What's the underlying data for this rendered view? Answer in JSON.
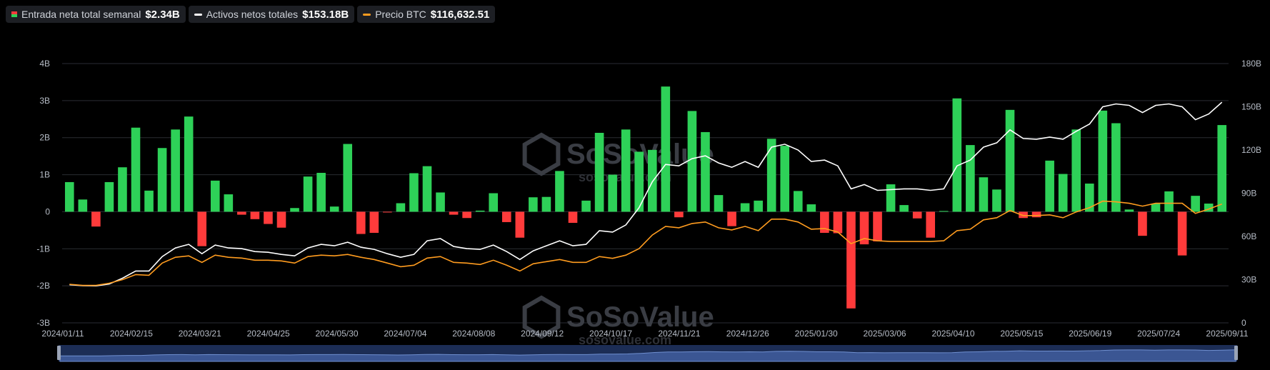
{
  "legend": {
    "inflow_label": "Entrada neta total semanal",
    "inflow_value": "$2.34B",
    "assets_label": "Activos netos totales",
    "assets_value": "$153.18B",
    "price_label": "Precio BTC",
    "price_value": "$116,632.51"
  },
  "watermark": {
    "text": "SoSoValue",
    "subtext": "sosovalue.com"
  },
  "colors": {
    "positive": "#2ed158",
    "negative": "#ff3b3b",
    "assets_line": "#ffffff",
    "price_line": "#ff9c1f"
  },
  "chart_data": {
    "type": "bar",
    "x_ticks": [
      "2024/01/11",
      "2024/02/15",
      "2024/03/21",
      "2024/04/25",
      "2024/05/30",
      "2024/07/04",
      "2024/08/08",
      "2024/09/12",
      "2024/10/17",
      "2024/11/21",
      "2024/12/26",
      "2025/01/30",
      "2025/03/06",
      "2025/04/10",
      "2025/05/15",
      "2025/06/19",
      "2025/07/24",
      "2025/09/11"
    ],
    "y_left": {
      "ticks": [
        "4B",
        "3B",
        "2B",
        "1B",
        "0",
        "-1B",
        "-2B",
        "-3B"
      ],
      "range": [
        -3,
        4
      ],
      "unit": "B"
    },
    "y_right": {
      "ticks": [
        "180B",
        "150B",
        "120B",
        "90B",
        "60B",
        "30B",
        "0"
      ],
      "range": [
        0,
        180
      ],
      "unit": "B"
    },
    "grid": true,
    "legend_position": "top-left",
    "series": [
      {
        "name": "Entrada neta total semanal",
        "type": "bar",
        "axis": "left",
        "values": [
          0.8,
          0.33,
          -0.4,
          0.8,
          1.2,
          2.27,
          0.57,
          1.72,
          2.22,
          2.57,
          -0.93,
          0.84,
          0.47,
          -0.08,
          -0.2,
          -0.33,
          -0.43,
          0.1,
          0.95,
          1.05,
          0.14,
          1.83,
          -0.6,
          -0.57,
          -0.02,
          0.23,
          1.04,
          1.23,
          0.52,
          -0.08,
          -0.17,
          0.03,
          0.5,
          -0.28,
          -0.7,
          0.39,
          0.4,
          1.1,
          -0.3,
          0.3,
          2.13,
          1.0,
          2.22,
          1.62,
          1.67,
          3.38,
          -0.15,
          2.72,
          2.15,
          0.45,
          -0.39,
          0.23,
          0.3,
          1.97,
          1.78,
          0.56,
          0.2,
          -0.57,
          -0.58,
          -2.61,
          -0.88,
          -0.8,
          0.74,
          0.18,
          -0.18,
          -0.7,
          0.02,
          3.06,
          1.8,
          0.93,
          0.6,
          2.75,
          -0.17,
          -0.15,
          1.38,
          1.02,
          2.22,
          0.76,
          2.73,
          2.39,
          0.06,
          -0.65,
          0.22,
          0.55,
          -1.18,
          0.43,
          0.22,
          2.34
        ]
      },
      {
        "name": "Activos netos totales",
        "type": "line",
        "axis": "right",
        "values": [
          26.5,
          25.8,
          25.7,
          27,
          31,
          36,
          36,
          46,
          52,
          54.5,
          48,
          54,
          52,
          51.5,
          49.5,
          49,
          47.5,
          46.5,
          52,
          54.5,
          53.5,
          56,
          52.5,
          51,
          48,
          45.5,
          47.5,
          57,
          58.5,
          53,
          51.5,
          51,
          54,
          49.5,
          44,
          50,
          53.5,
          57,
          53.5,
          54.5,
          64,
          63,
          68,
          80,
          98,
          110,
          109,
          114,
          116,
          111,
          108,
          112,
          108,
          122,
          124,
          120,
          112,
          113,
          109,
          93,
          96,
          92,
          92.5,
          93,
          93,
          92,
          93,
          109,
          113,
          122,
          125,
          134,
          128,
          127.5,
          129,
          127.5,
          133,
          138,
          150,
          152,
          151,
          146,
          151,
          152,
          150,
          141,
          145,
          153.18
        ]
      },
      {
        "name": "Precio BTC",
        "type": "line",
        "axis": "right",
        "values": [
          26.8,
          26,
          26,
          27.5,
          30,
          33.5,
          33,
          41.5,
          45.5,
          46.5,
          42,
          47,
          45.5,
          45,
          43.5,
          43.5,
          43,
          41.5,
          46,
          47,
          46.5,
          47.5,
          45.5,
          44,
          41.5,
          39,
          40,
          45,
          46,
          42,
          41.5,
          40.5,
          43.5,
          40,
          36,
          41,
          42.5,
          44,
          42,
          42,
          46,
          44.8,
          47,
          51.5,
          61,
          67,
          66,
          69,
          70,
          66,
          64.5,
          67,
          64,
          72,
          72,
          70,
          65,
          65.5,
          63,
          55,
          58.5,
          57,
          56.5,
          56.5,
          56.5,
          56.5,
          57,
          64,
          65,
          71.5,
          73,
          78,
          74.5,
          74.5,
          75,
          73,
          77,
          80,
          84.5,
          84,
          83,
          81,
          83,
          83,
          83,
          76,
          79,
          82.5
        ]
      }
    ]
  }
}
